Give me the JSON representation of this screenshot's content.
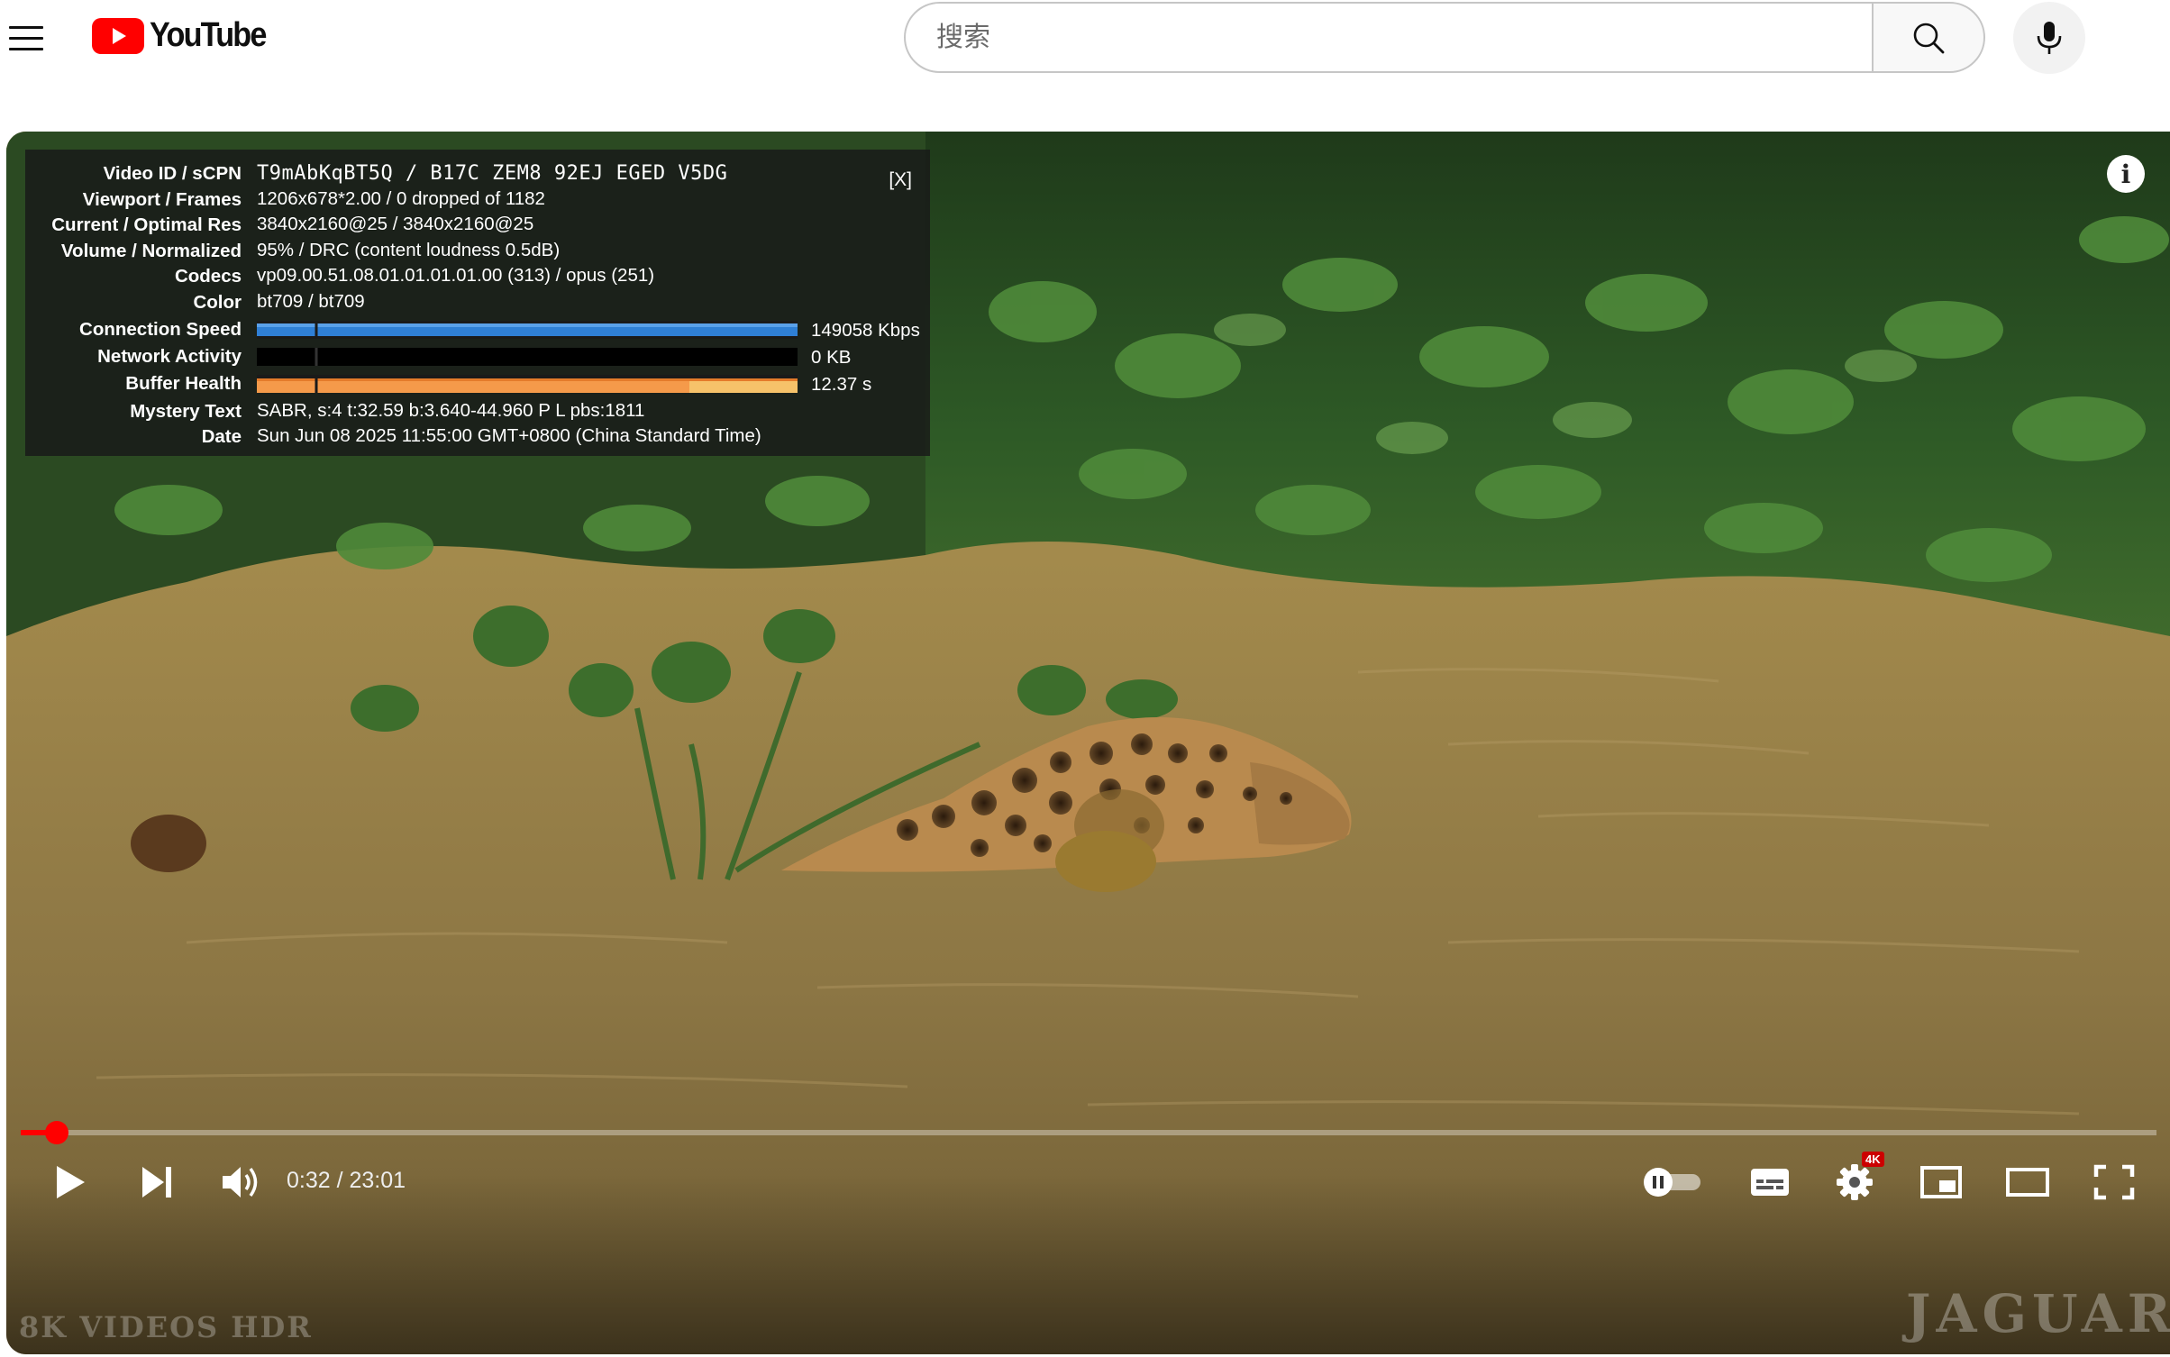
{
  "masthead": {
    "logo_text": "YouTube",
    "search_placeholder": "搜索",
    "icons": [
      "menu-icon",
      "youtube-logo-icon",
      "search-icon",
      "mic-icon"
    ]
  },
  "stats": {
    "close_label": "[X]",
    "rows": [
      {
        "label": "Video ID / sCPN",
        "value": "T9mAbKqBT5Q / B17C ZEM8 92EJ EGED V5DG"
      },
      {
        "label": "Viewport / Frames",
        "value": "1206x678*2.00 / 0 dropped of 1182"
      },
      {
        "label": "Current / Optimal Res",
        "value": "3840x2160@25 / 3840x2160@25"
      },
      {
        "label": "Volume / Normalized",
        "value": "95% / DRC (content loudness 0.5dB)"
      },
      {
        "label": "Codecs",
        "value": "vp09.00.51.08.01.01.01.01.00 (313) / opus (251)"
      },
      {
        "label": "Color",
        "value": "bt709 / bt709"
      },
      {
        "label": "Connection Speed",
        "value": "149058 Kbps"
      },
      {
        "label": "Network Activity",
        "value": "0 KB"
      },
      {
        "label": "Buffer Health",
        "value": "12.37 s"
      },
      {
        "label": "Mystery Text",
        "value": "SABR, s:4 t:32.59 b:3.640-44.960 P L pbs:1811"
      },
      {
        "label": "Date",
        "value": "Sun Jun 08 2025 11:55:00 GMT+0800 (China Standard Time)"
      }
    ],
    "colors": {
      "connection": "#2f7fd6",
      "buffer": "#f59a4a",
      "buffer_light": "#f6c26a"
    }
  },
  "player": {
    "time": "0:32 / 23:01",
    "progress_fraction": 0.0168,
    "watermark_left": "8K VIDEOS HDR",
    "watermark_right": "JAGUAR",
    "quality_badge": "4K",
    "info_label": "i",
    "accent_color": "#ff0000",
    "icons": [
      "play-icon",
      "next-icon",
      "volume-icon",
      "autoplay-toggle-icon",
      "subtitles-icon",
      "settings-icon",
      "miniplayer-icon",
      "theater-mode-icon",
      "fullscreen-icon"
    ]
  }
}
